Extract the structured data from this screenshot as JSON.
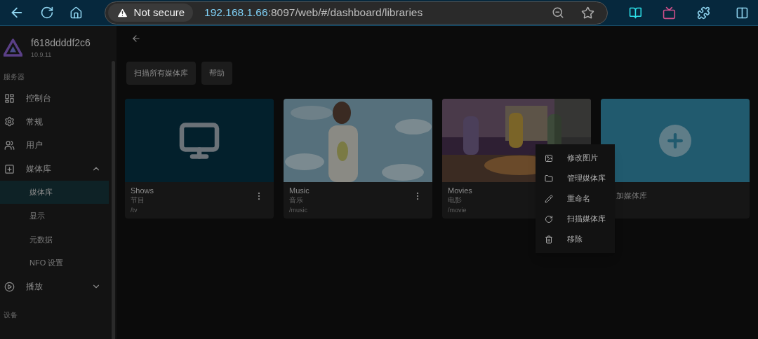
{
  "browser": {
    "security": "Not secure",
    "url_host": "192.168.1.66",
    "url_path": ":8097/web/#/dashboard/libraries"
  },
  "sidebar": {
    "server_name": "f618ddddf2c6",
    "version": "10.9.11",
    "sections": [
      {
        "title": "服务器",
        "items": [
          {
            "label": "控制台",
            "selected": false
          },
          {
            "label": "常规",
            "selected": false
          },
          {
            "label": "用户",
            "selected": false
          },
          {
            "label": "媒体库",
            "expanded": true,
            "selected": false,
            "children": [
              {
                "label": "媒体库",
                "selected": true
              },
              {
                "label": "显示",
                "selected": false
              },
              {
                "label": "元数据",
                "selected": false
              },
              {
                "label": "NFO 设置",
                "selected": false
              }
            ]
          },
          {
            "label": "播放",
            "expanded": false,
            "selected": false
          }
        ]
      },
      {
        "title": "设备"
      }
    ]
  },
  "toolbar": {
    "buttons": [
      "扫描所有媒体库",
      "帮助"
    ]
  },
  "cards": [
    {
      "kind": "icon",
      "title": "Shows",
      "subtitle": "节目",
      "path": "/tv",
      "menu_open": false
    },
    {
      "kind": "picture",
      "title": "Music",
      "subtitle": "音乐",
      "path": "/music",
      "menu_open": false
    },
    {
      "kind": "picture",
      "title": "Movies",
      "subtitle": "电影",
      "path": "/movie",
      "menu_open": true
    },
    {
      "kind": "add",
      "title": "加媒体库"
    }
  ],
  "context_menu": [
    {
      "label": "修改图片"
    },
    {
      "label": "管理媒体库"
    },
    {
      "label": "重命名"
    },
    {
      "label": "扫描媒体库"
    },
    {
      "label": "移除"
    }
  ]
}
